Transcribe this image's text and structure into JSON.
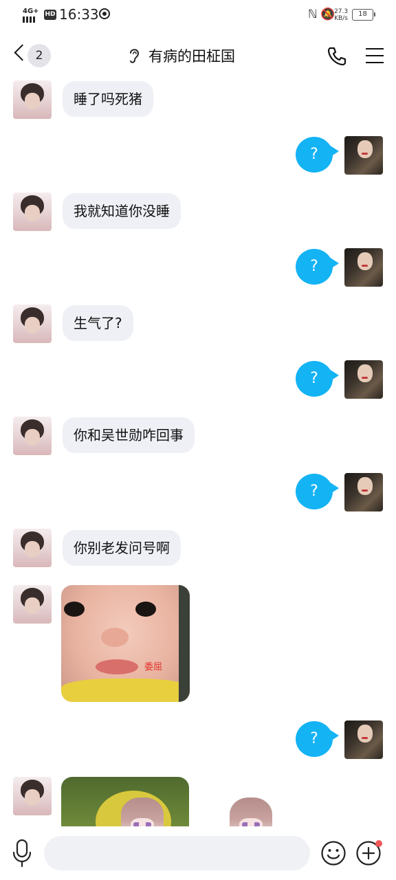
{
  "status_bar": {
    "network": "4G+",
    "hd": "HD",
    "time": "16:33",
    "speed_value": "27.3",
    "speed_unit": "KB/s",
    "battery": "18"
  },
  "nav": {
    "unread_count": "2",
    "title": "有病的田柾国"
  },
  "messages": [
    {
      "side": "left",
      "text": "睡了吗死猪"
    },
    {
      "side": "right",
      "text": "?"
    },
    {
      "side": "left",
      "text": "我就知道你没睡"
    },
    {
      "side": "right",
      "text": "?"
    },
    {
      "side": "left",
      "text": "生气了?"
    },
    {
      "side": "right",
      "text": "?"
    },
    {
      "side": "left",
      "text": "你和吴世勋咋回事"
    },
    {
      "side": "right",
      "text": "?"
    },
    {
      "side": "left",
      "text": "你别老发问号啊"
    },
    {
      "side": "left",
      "type": "sticker",
      "caption": "委屈"
    },
    {
      "side": "right",
      "text": "?"
    },
    {
      "side": "left",
      "type": "sticker"
    }
  ],
  "input": {
    "placeholder": ""
  },
  "colors": {
    "outgoing_bubble": "#13b3f4",
    "incoming_bubble": "#eef0f5",
    "notification_dot": "#f35757"
  }
}
